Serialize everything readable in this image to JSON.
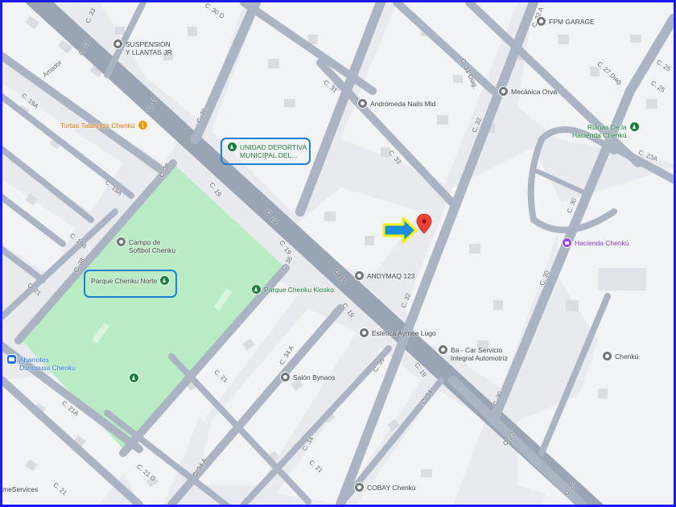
{
  "colors": {
    "frame_border": "#1a1aff",
    "land": "#e8eaed",
    "road": "#aab4c2",
    "major_road": "#9aa5b3",
    "park": "#b9ecc4",
    "block": "#f1f3f4",
    "building": "#dadce0",
    "highlight": "#1d7fd1",
    "arrow_fill": "#1a8fe0",
    "arrow_outline": "#f4f10a",
    "pin": "#ea4335"
  },
  "pois": {
    "suspension": {
      "label": "SUSPENSION\nY LLANTAS JR",
      "icon": "pin-icon"
    },
    "fm_garage": {
      "label": "FPM GARAGE",
      "icon": "pin-icon"
    },
    "tortas": {
      "label": "Tortas Talango's Chenkú",
      "icon": "restaurant-icon"
    },
    "unidad": {
      "label": "UNIDAD DEPORTIVA\nMUNICIPAL DEL...",
      "icon": "park-icon"
    },
    "andromeda": {
      "label": "Andrómeda Nails Mid",
      "icon": "pin-icon"
    },
    "mecanica": {
      "label": "Mecánica Orva",
      "icon": "pin-icon"
    },
    "ruinas": {
      "label": "Ruinas De la\nHacienda Chenkú",
      "icon": "park-icon"
    },
    "hacienda": {
      "label": "Hacienda Chenkú",
      "icon": "hotel-icon"
    },
    "softbol": {
      "label": "Campo de\nSoftbol Chenku",
      "icon": "pin-icon"
    },
    "parque_norte": {
      "label": "Parque Chenku Norte",
      "icon": "park-icon"
    },
    "kiosko": {
      "label": "Parque Chenku Kiosko",
      "icon": "park-icon"
    },
    "andymaq": {
      "label": "ANDYMAQ 123",
      "icon": "pin-icon"
    },
    "estetica": {
      "label": "Estética Aymee Lugo",
      "icon": "pin-icon"
    },
    "bacar": {
      "label": "Ba - Car Servicio\nIntegral Automotriz",
      "icon": "pin-icon"
    },
    "chenku": {
      "label": "Chenkú",
      "icon": "pin-icon"
    },
    "abarrotes": {
      "label": "Abarrotes\nDunosusa Chenku",
      "icon": "shop-icon"
    },
    "salon": {
      "label": "Salón Bynaos",
      "icon": "pin-icon"
    },
    "cobay": {
      "label": "COBAY Chenkú",
      "icon": "pin-icon"
    },
    "services": {
      "label": "meServices",
      "icon": ""
    }
  },
  "streets": {
    "c19_a": "C. 19",
    "c19_b": "C. 19",
    "c19_c": "C. 19",
    "c19_d": "C. 19",
    "c19_e": "C. 19",
    "c19_f": "C. 19",
    "c19_g": "C. 19",
    "c19_h": "C. 19",
    "c33": "C. 33",
    "c30d": "C. 30 D",
    "c36": "C. 36",
    "c38": "C. 38",
    "c38b": "C. 38",
    "c36b": "C. 36",
    "c31": "C. 31",
    "c31d": "C. 31 Diag.",
    "c33b": "C. 33",
    "c32": "C. 32",
    "c32b": "C. 32",
    "c27d": "C. 27 Diag.",
    "c25": "C. 25",
    "c23a": "C. 23A",
    "c19a": "C. 19A",
    "c19a2": "C. 19A",
    "c19b": "C. 19B",
    "c21": "C. 21",
    "c21a": "C. 21A",
    "c21b": "C. 21",
    "c21c": "C. 21",
    "c21d": "C. 21",
    "c34a": "C. 34 A",
    "c34a2": "C. 34 A",
    "c34": "C. 34",
    "c34b": "C. 34",
    "c30": "C. 30",
    "c30b": "C. 30",
    "c30c": "C. 30",
    "c27": "C. 27",
    "c27b": "C. 27",
    "c21g": "C. 21 G",
    "c32a": "C. 32 A",
    "c36c": "C. 36",
    "c25b": "C. 25",
    "amador": "Amador"
  }
}
